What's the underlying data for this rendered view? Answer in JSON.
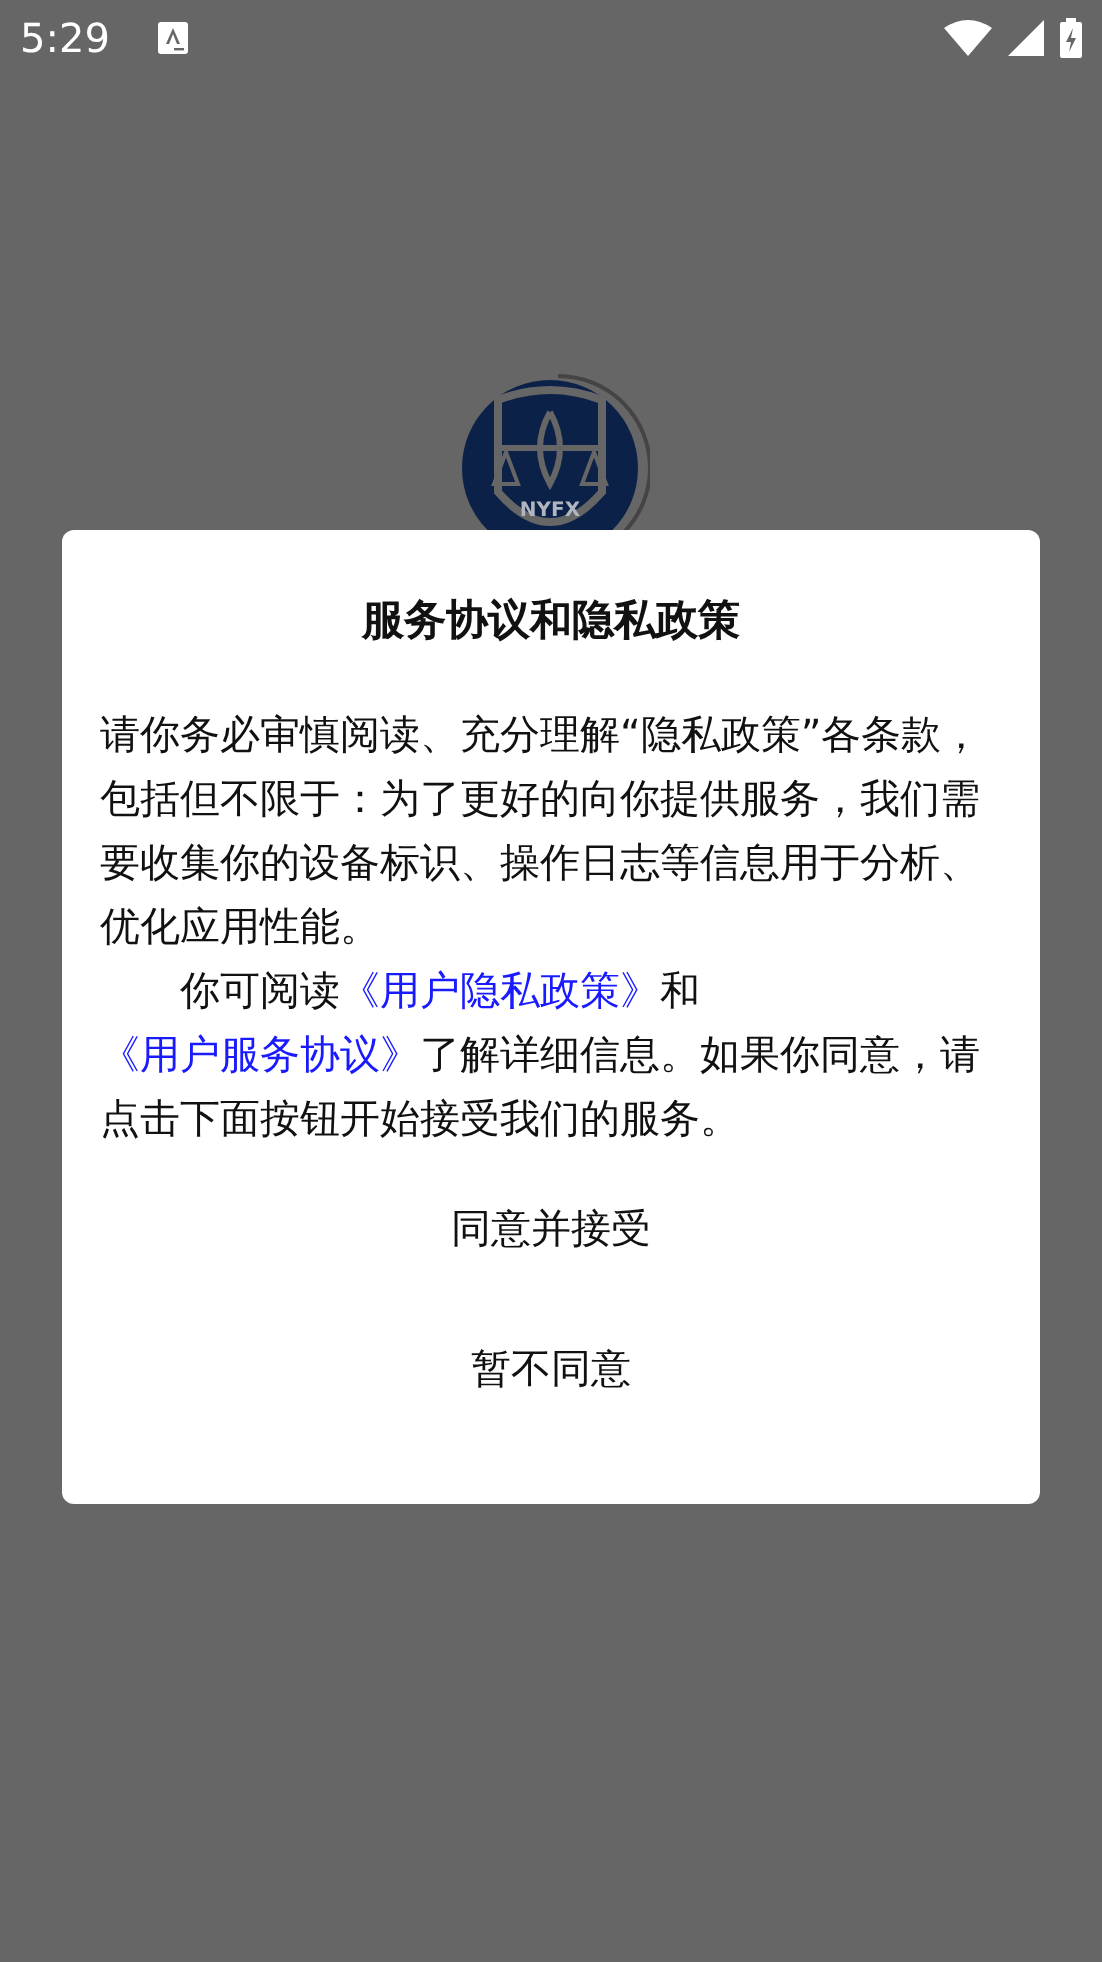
{
  "status_bar": {
    "time": "5:29"
  },
  "logo": {
    "text": "NYFX"
  },
  "dialog": {
    "title": "服务协议和隐私政策",
    "paragraphs": [
      {
        "indent": false,
        "segments": [
          {
            "kind": "text",
            "text": "请你务必审慎阅读、充分理解“隐私政策”各条款，包括但不限于：为了更好的向你提供服务，我们需要收集你的设备标识、操作日志等信息用于分析、优化应用性能。"
          }
        ]
      },
      {
        "indent": true,
        "segments": [
          {
            "kind": "text",
            "text": "你可阅读"
          },
          {
            "kind": "link",
            "text": "《用户隐私政策》"
          },
          {
            "kind": "text",
            "text": "和"
          },
          {
            "kind": "link",
            "text": "《用户服务协议》"
          },
          {
            "kind": "text",
            "text": "了解详细信息。如果你同意，请点击下面按钮开始接受我们的服务。"
          }
        ]
      }
    ],
    "buttons": [
      "同意并接受",
      "暂不同意"
    ]
  }
}
